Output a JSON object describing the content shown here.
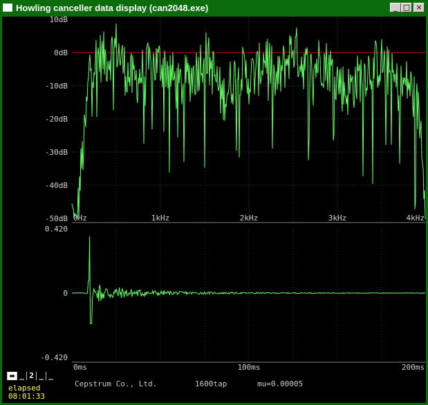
{
  "window": {
    "title": "Howling canceller data display (can2048.exe)",
    "buttons": {
      "minimize": "_",
      "maximize": "□",
      "close": "×"
    }
  },
  "spectrum_chart": {
    "type": "line",
    "y_ticks": [
      "10dB",
      "0dB",
      "-10dB",
      "-20dB",
      "-30dB",
      "-40dB",
      "-50dB"
    ],
    "x_ticks": [
      "0Hz",
      "1kHz",
      "2kHz",
      "3kHz",
      "4kHz"
    ],
    "ylim": [
      -50,
      10
    ],
    "xlim": [
      0,
      4000
    ],
    "reference_line_db": 0,
    "series_color": "#60ff60",
    "reference_color": "#c01010"
  },
  "impulse_chart": {
    "type": "line",
    "y_ticks": [
      "0.420",
      "0",
      "-0.420"
    ],
    "x_ticks": [
      "0ms",
      "100ms",
      "200ms"
    ],
    "ylim": [
      -0.42,
      0.42
    ],
    "xlim": [
      0,
      200
    ],
    "series_color": "#60ff60"
  },
  "chart_data": [
    {
      "type": "line",
      "xlabel": "",
      "ylabel": "",
      "x_unit": "Hz",
      "y_unit": "dB",
      "xlim": [
        0,
        4000
      ],
      "ylim": [
        -50,
        10
      ],
      "x": [
        0,
        50,
        100,
        150,
        200,
        300,
        400,
        500,
        600,
        700,
        800,
        900,
        1000,
        1100,
        1200,
        1300,
        1400,
        1500,
        1600,
        1700,
        1800,
        1900,
        2000,
        2100,
        2200,
        2300,
        2400,
        2500,
        2600,
        2700,
        2800,
        2900,
        3000,
        3100,
        3200,
        3300,
        3400,
        3500,
        3600,
        3700,
        3800,
        3900,
        3950,
        4000
      ],
      "series": [
        {
          "values": [
            -42,
            -48,
            -30,
            -18,
            2,
            5,
            4,
            8,
            1,
            -3,
            0,
            2,
            3,
            1,
            -5,
            -2,
            0,
            6,
            0,
            -8,
            -3,
            1,
            -2,
            0,
            6,
            -4,
            2,
            8,
            3,
            0,
            4,
            2,
            -2,
            -6,
            -3,
            0,
            2,
            3,
            -1,
            -5,
            -3,
            -10,
            -18,
            -42
          ]
        }
      ]
    },
    {
      "type": "line",
      "xlabel": "",
      "ylabel": "",
      "x_unit": "ms",
      "xlim": [
        0,
        200
      ],
      "ylim": [
        -0.42,
        0.42
      ],
      "x": [
        0,
        5,
        8,
        10,
        12,
        15,
        20,
        30,
        40,
        50,
        60,
        80,
        100,
        120,
        150,
        200
      ],
      "series": [
        {
          "values": [
            0,
            0,
            0.01,
            0.37,
            -0.2,
            0.16,
            0.12,
            0.07,
            0.05,
            0.035,
            0.025,
            0.015,
            0.01,
            0.007,
            0.005,
            0.003
          ]
        }
      ]
    }
  ],
  "status": {
    "mode_tabs": [
      "▬",
      "_",
      "2",
      "_",
      "_"
    ],
    "active_tab": 0,
    "elapsed_label": "elapsed",
    "elapsed_time": "08:01:33",
    "company": "Cepstrum Co., Ltd.",
    "taps": "1600tap",
    "mu": "mu=0.00005"
  }
}
